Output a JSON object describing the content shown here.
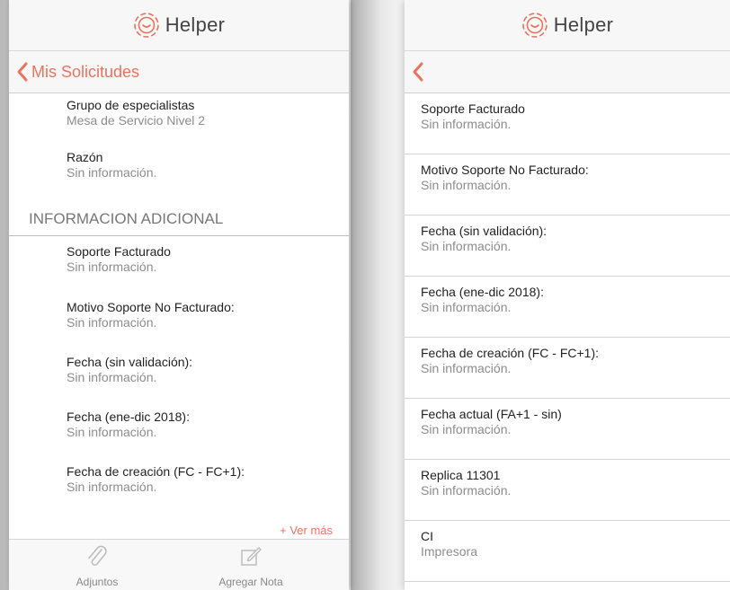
{
  "app": {
    "brand_name": "Helper",
    "accent_color": "#e8735f"
  },
  "left_panel": {
    "nav": {
      "back_label": "Mis Solicitudes"
    },
    "fields_top": [
      {
        "label": "Grupo de especialistas",
        "value": "Mesa de Servicio Nivel 2"
      },
      {
        "label": "Razón",
        "value": "Sin información."
      }
    ],
    "section_title": "INFORMACION ADICIONAL",
    "fields_additional": [
      {
        "label": "Soporte Facturado",
        "value": "Sin información."
      },
      {
        "label": "Motivo Soporte No Facturado:",
        "value": "Sin información."
      },
      {
        "label": "Fecha (sin validación):",
        "value": "Sin información."
      },
      {
        "label": "Fecha (ene-dic 2018):",
        "value": "Sin información."
      },
      {
        "label": "Fecha de creación (FC - FC+1):",
        "value": "Sin información."
      }
    ],
    "ver_mas": "+ Ver más",
    "tabbar": [
      {
        "label": "Adjuntos",
        "icon": "paperclip-icon"
      },
      {
        "label": "Agregar Nota",
        "icon": "edit-note-icon"
      }
    ]
  },
  "right_panel": {
    "fields": [
      {
        "label": "Soporte Facturado",
        "value": "Sin información."
      },
      {
        "label": "Motivo Soporte No Facturado:",
        "value": "Sin información."
      },
      {
        "label": "Fecha (sin validación):",
        "value": "Sin información."
      },
      {
        "label": "Fecha (ene-dic 2018):",
        "value": "Sin información."
      },
      {
        "label": "Fecha de creación (FC - FC+1):",
        "value": "Sin información."
      },
      {
        "label": "Fecha actual (FA+1 - sin)",
        "value": "Sin información."
      },
      {
        "label": "Replica 11301",
        "value": "Sin información."
      },
      {
        "label": "CI",
        "value": "Impresora"
      }
    ]
  }
}
